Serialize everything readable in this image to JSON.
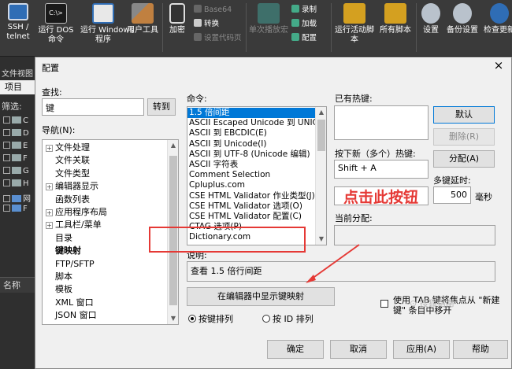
{
  "ribbon": {
    "ssh": "SSH /\ntelnet",
    "dos": "运行 DOS\n命令",
    "dos_icon_text": "C:\\>",
    "windows": "运行 Windows\n程序",
    "tools": "用户工具",
    "encrypt": "加密",
    "base64": "Base64",
    "convert": "转换",
    "set_code_page": "设置代码页",
    "play_once": "单次播放宏",
    "record": "录制",
    "load": "加载",
    "config": "配置",
    "run_active_script": "运行活动脚本",
    "all_scripts": "所有脚本",
    "settings": "设置",
    "backup_settings": "备份设置",
    "check_update": "检查更新"
  },
  "side": {
    "file_view": "文件视图",
    "tab": "项目",
    "filter": "筛选:",
    "rows": [
      "C",
      "D",
      "E",
      "F",
      "G",
      "H",
      "网",
      "F"
    ],
    "name_header": "名称"
  },
  "dialog": {
    "title": "配置",
    "close": "×",
    "find_label": "查找:",
    "find_value": "键",
    "goto": "转到",
    "nav_label": "导航(N):",
    "nav": [
      {
        "label": "文件处理",
        "expand": "+",
        "bold": false
      },
      {
        "label": "文件关联",
        "expand": "",
        "bold": false
      },
      {
        "label": "文件类型",
        "expand": "",
        "bold": false
      },
      {
        "label": "编辑器显示",
        "expand": "+",
        "bold": false
      },
      {
        "label": "函数列表",
        "expand": "",
        "bold": false
      },
      {
        "label": "应用程序布局",
        "expand": "+",
        "bold": false
      },
      {
        "label": "工具栏/菜单",
        "expand": "+",
        "bold": false
      },
      {
        "label": "目录",
        "expand": "",
        "bold": false
      },
      {
        "label": "键映射",
        "expand": "",
        "bold": true
      },
      {
        "label": "FTP/SFTP",
        "expand": "",
        "bold": false
      },
      {
        "label": "脚本",
        "expand": "",
        "bold": false
      },
      {
        "label": "模板",
        "expand": "",
        "bold": false
      },
      {
        "label": "XML 窗口",
        "expand": "",
        "bold": false
      },
      {
        "label": "JSON 窗口",
        "expand": "",
        "bold": false
      }
    ],
    "commands_label": "命令:",
    "commands": [
      "1.5 倍间距",
      "ASCII Escaped Unicode 到 UNICODE",
      "ASCII 到 EBCDIC(E)",
      "ASCII 到 Unicode(I)",
      "ASCII 到 UTF-8 (Unicode 编辑)",
      "ASCII 字符表",
      "Comment Selection",
      "Cpluplus.com",
      "CSE HTML Validator 作业类型(J)",
      "CSE HTML Validator 选项(O)",
      "CSE HTML Validator 配置(C)",
      "CTAG 选项(P)",
      "Dictionary.com"
    ],
    "existing_hotkeys_label": "已有热键:",
    "default_btn": "默认",
    "delete_btn": "删除(R)",
    "assign_btn": "分配(A)",
    "press_new_label": "按下新（多个）热键:",
    "hotkey_value": "Shift + A",
    "multi_delay_label": "多键延时:",
    "delay_value": "500",
    "delay_unit": "毫秒",
    "current_assign_label": "当前分配:",
    "desc_label": "说明:",
    "desc_value": "查看 1.5 倍行间距",
    "show_keymap_btn": "在编辑器中显示键映射",
    "sort_by_key": "按键排列",
    "sort_by_id": "按 ID 排列",
    "tab_option": "使用 TAB 键将焦点从 \"新建键\" 条目中移开",
    "ok": "确定",
    "cancel": "取消",
    "apply": "应用(A)",
    "help": "帮助"
  },
  "annotation": {
    "text": "点击此按钮"
  },
  "watermark": "⊙ 搜狐指南"
}
